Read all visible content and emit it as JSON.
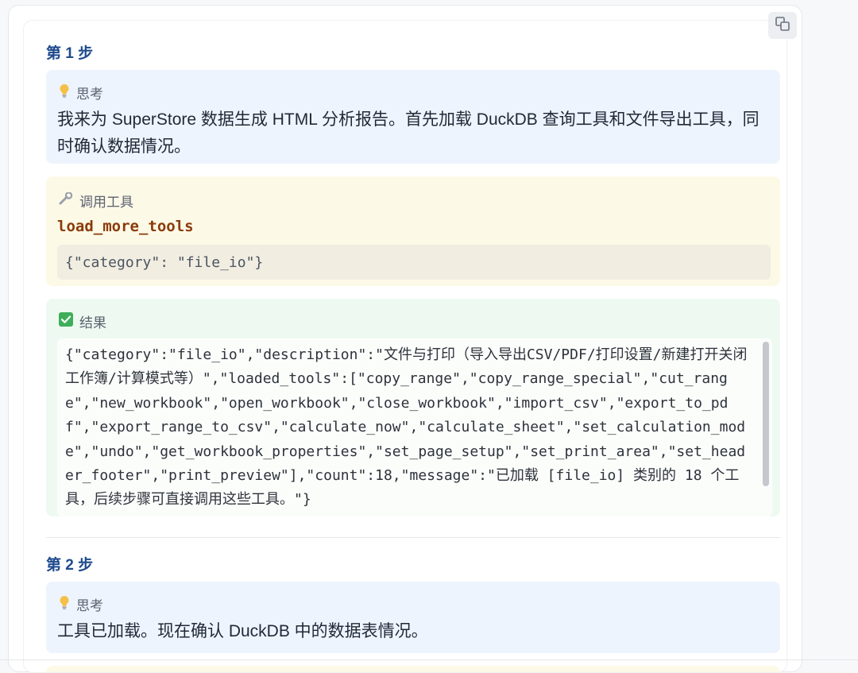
{
  "steps": [
    {
      "title": "第 1 步",
      "think_label": "思考",
      "think_text": "我来为 SuperStore 数据生成 HTML 分析报告。首先加载 DuckDB 查询工具和文件导出工具，同时确认数据情况。",
      "tool_label": "调用工具",
      "tool_name": "load_more_tools",
      "tool_args": "{\"category\": \"file_io\"}",
      "result_label": "结果",
      "result_text": "{\"category\":\"file_io\",\"description\":\"文件与打印（导入导出CSV/PDF/打印设置/新建打开关闭工作簿/计算模式等）\",\"loaded_tools\":[\"copy_range\",\"copy_range_special\",\"cut_range\",\"new_workbook\",\"open_workbook\",\"close_workbook\",\"import_csv\",\"export_to_pdf\",\"export_range_to_csv\",\"calculate_now\",\"calculate_sheet\",\"set_calculation_mode\",\"undo\",\"get_workbook_properties\",\"set_page_setup\",\"set_print_area\",\"set_header_footer\",\"print_preview\"],\"count\":18,\"message\":\"已加载 [file_io] 类别的 18 个工具，后续步骤可直接调用这些工具。\"}"
    },
    {
      "title": "第 2 步",
      "think_label": "思考",
      "think_text": "工具已加载。现在确认 DuckDB 中的数据表情况。"
    }
  ],
  "icons": {
    "think": "lightbulb-icon",
    "tool": "wrench-icon",
    "result": "check-box-icon",
    "copy": "copy-icon"
  },
  "colors": {
    "step_title": "#1e4a8c",
    "think_bg": "#eef4fd",
    "tool_bg": "#fdf9e7",
    "result_bg": "#eefaf1",
    "tool_name": "#8a3b0a",
    "check": "#3fae5a"
  }
}
